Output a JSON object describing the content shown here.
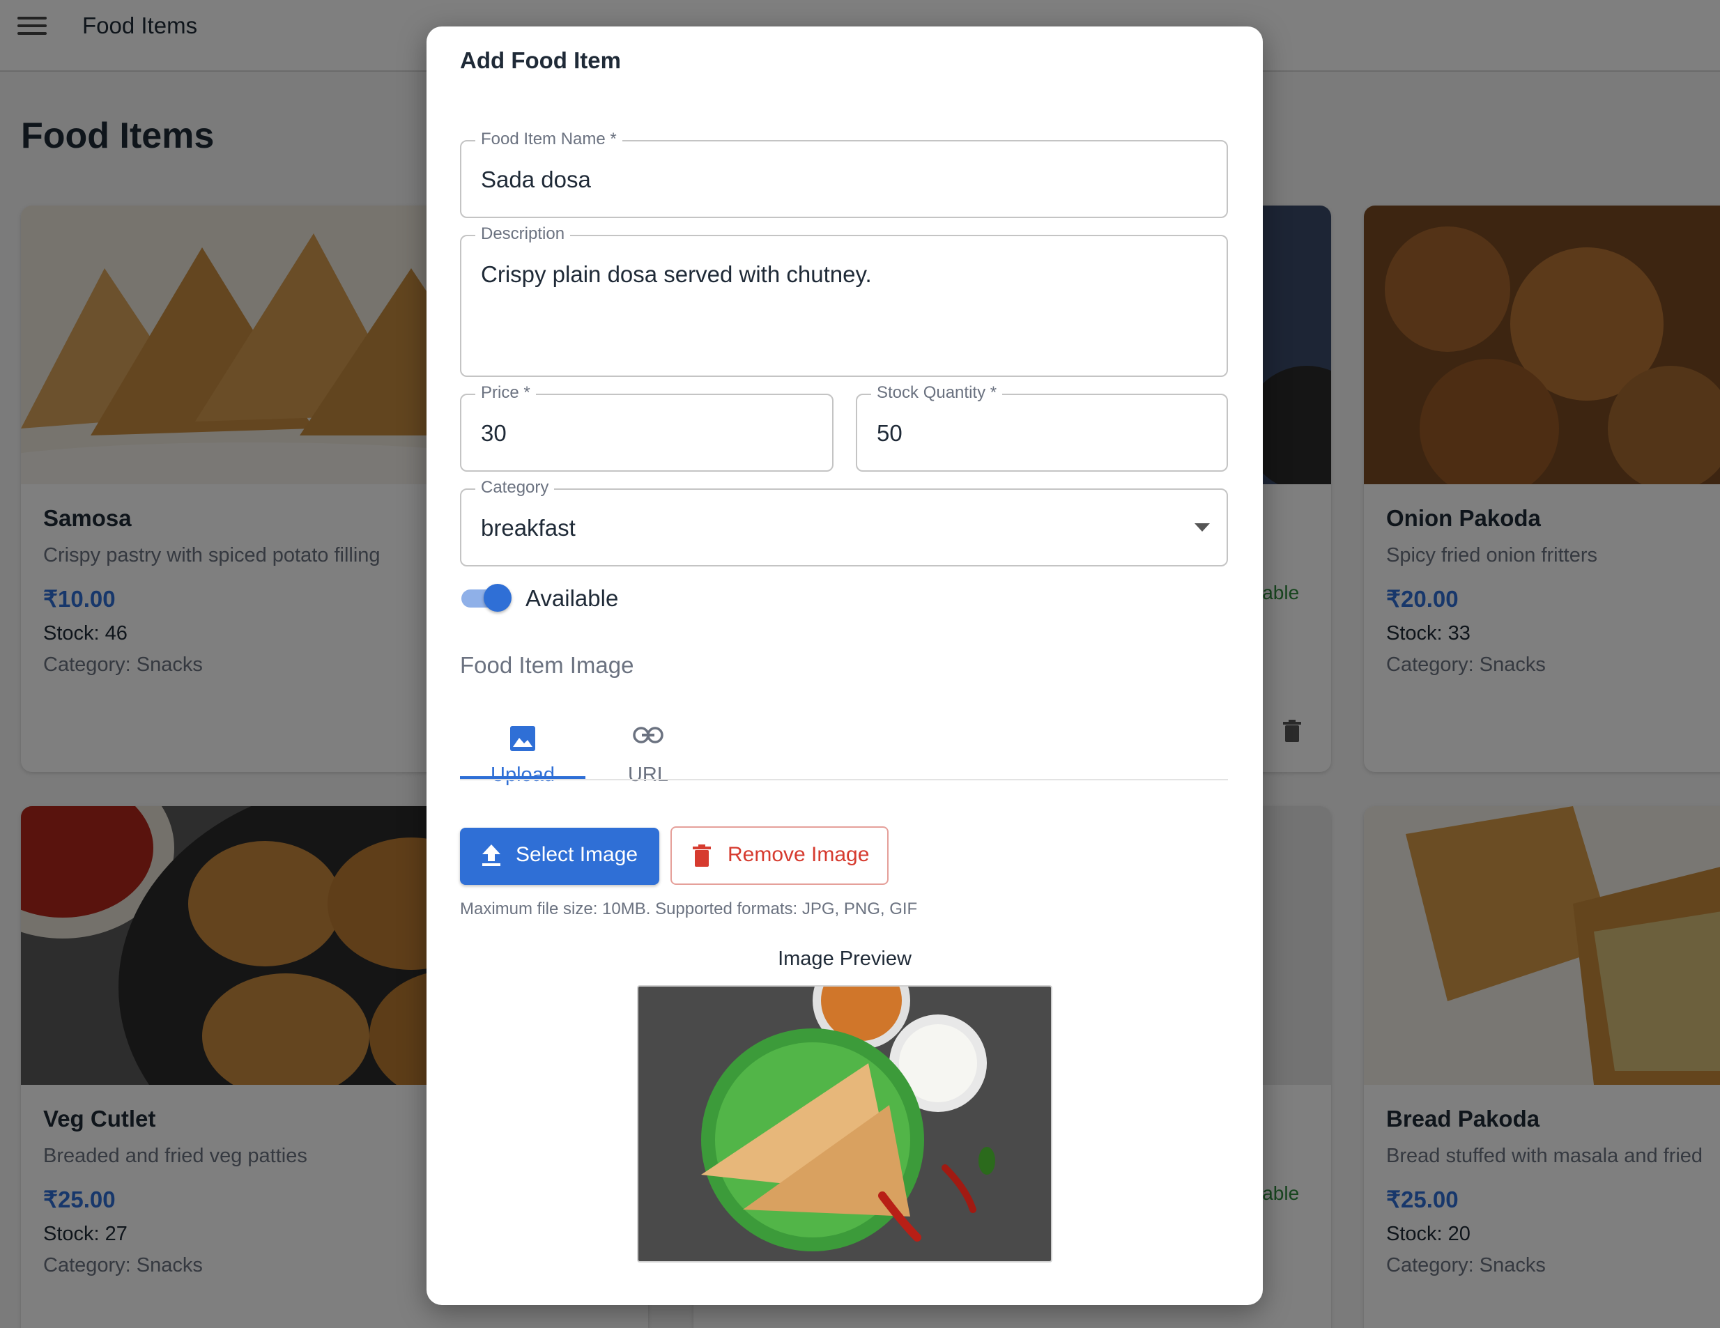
{
  "appbar": {
    "title": "Food Items",
    "menu_icon": "menu-icon"
  },
  "page": {
    "title": "Food Items"
  },
  "cards": [
    {
      "name": "Samosa",
      "description": "Crispy pastry with spiced potato filling",
      "price": "₹10.00",
      "stock": "Stock: 46",
      "category": "Category: Snacks"
    },
    {
      "name": "Onion Pakoda",
      "description": "Spicy fried onion fritters",
      "price": "₹20.00",
      "stock": "Stock: 33",
      "category": "Category: Snacks"
    },
    {
      "name": "Veg Cutlet",
      "description": "Breaded and fried veg patties",
      "price": "₹25.00",
      "stock": "Stock: 27",
      "category": "Category: Snacks"
    },
    {
      "name": "Bread Pakoda",
      "description": "Bread stuffed with masala and fried",
      "price": "₹25.00",
      "stock": "Stock: 20",
      "category": "Category: Snacks"
    }
  ],
  "hidden_fragments": {
    "available_1": "lable",
    "available_2": "lable"
  },
  "dialog": {
    "title": "Add Food Item",
    "fields": {
      "name": {
        "label": "Food Item Name *",
        "value": "Sada dosa"
      },
      "description": {
        "label": "Description",
        "value": "Crispy plain dosa served with chutney."
      },
      "price": {
        "label": "Price *",
        "value": "30"
      },
      "stock": {
        "label": "Stock Quantity *",
        "value": "50"
      },
      "category": {
        "label": "Category",
        "value": "breakfast"
      }
    },
    "available": {
      "label": "Available",
      "checked": true
    },
    "image_section": {
      "label": "Food Item Image",
      "tabs": [
        {
          "label": "Upload",
          "icon": "image-icon",
          "active": true
        },
        {
          "label": "URL",
          "icon": "link-icon",
          "active": false
        }
      ],
      "select_button": "Select Image",
      "remove_button": "Remove Image",
      "hint": "Maximum file size: 10MB. Supported formats: JPG, PNG, GIF",
      "preview_title": "Image Preview"
    }
  },
  "colors": {
    "primary": "#2f6fd6",
    "danger": "#d63b2f",
    "success": "#2e8b3d",
    "overlay": "rgba(0,0,0,0.5)"
  }
}
